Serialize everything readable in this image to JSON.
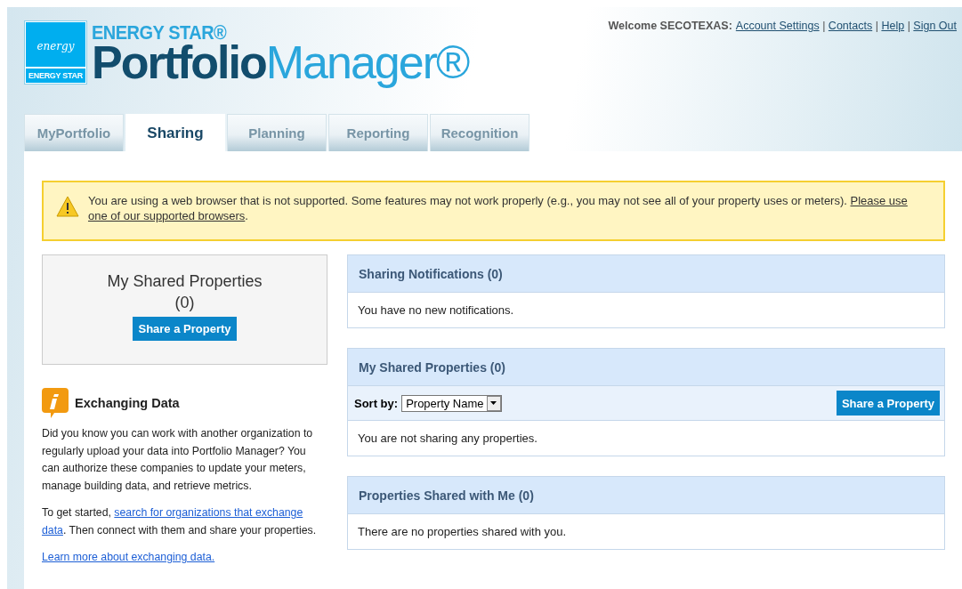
{
  "header": {
    "logo": {
      "icon_script": "energy",
      "icon_label": "ENERGY STAR",
      "brand": "ENERGY STAR®",
      "product_dark": "Portfolio",
      "product_light": "Manager®"
    },
    "welcome": "Welcome SECOTEXAS:",
    "separator": "|",
    "links": [
      "Account Settings",
      "Contacts",
      "Help",
      "Sign Out"
    ]
  },
  "tabs": [
    {
      "label": "MyPortfolio",
      "selected": false
    },
    {
      "label": "Sharing",
      "selected": true
    },
    {
      "label": "Planning",
      "selected": false
    },
    {
      "label": "Reporting",
      "selected": false
    },
    {
      "label": "Recognition",
      "selected": false
    }
  ],
  "alert": {
    "text": "You are using a web browser that is not supported. Some features may not work properly (e.g., you may not see all of your property uses or meters). ",
    "link_parts": [
      "Please use",
      "one of our supported browsers"
    ],
    "end": "."
  },
  "summary": {
    "title": "My Shared Properties",
    "count": "(0)",
    "button": "Share a Property"
  },
  "info": {
    "title": "Exchanging Data",
    "paragraph": "Did you know you can work with another organization to regularly upload your data into Portfolio Manager? You can authorize these companies to update your meters, manage building data, and retrieve metrics.",
    "start_before": "To get started, ",
    "start_link_parts": [
      "search for organizations that exchange",
      "data"
    ],
    "start_after": ". Then connect with them and share your properties.",
    "more_link": "Learn more about exchanging data."
  },
  "panels": [
    {
      "title": "Sharing Notifications (0)",
      "message": "You have no new notifications."
    },
    {
      "title": "My Shared Properties (0)",
      "sort_label": "Sort by:",
      "sort_value": "Property Name",
      "button": "Share a Property",
      "message": "You are not sharing any properties."
    },
    {
      "title": "Properties Shared with Me (0)",
      "message": "There are no properties shared with you."
    }
  ]
}
